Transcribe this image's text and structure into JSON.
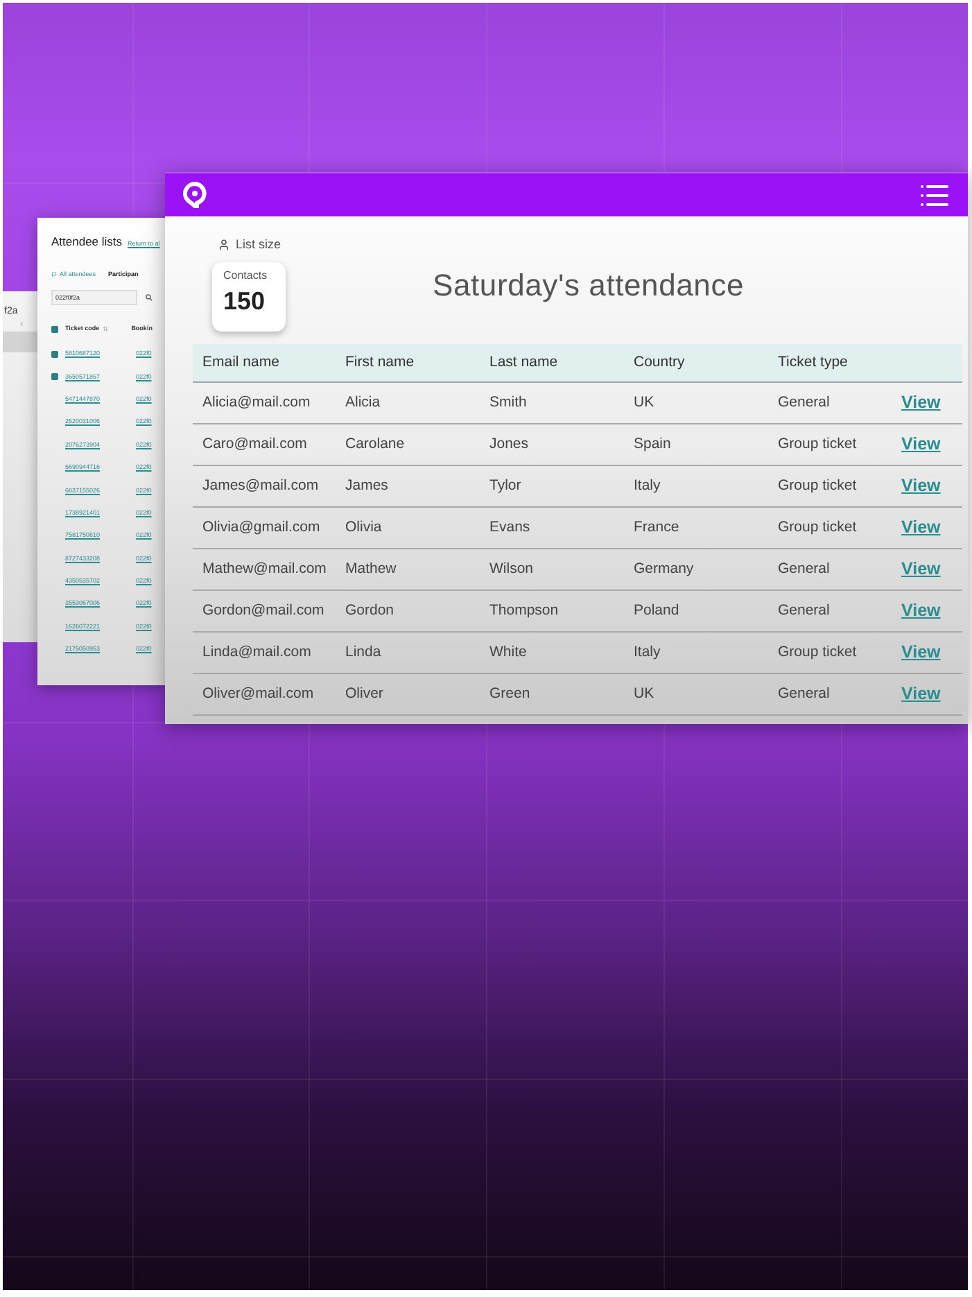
{
  "left_window": {
    "text": "f2a"
  },
  "attendee_window": {
    "title": "Attendee lists",
    "link": "Return to al",
    "tabs": [
      {
        "label": "All attendees",
        "selected": true
      },
      {
        "label": "Participan",
        "selected": false
      }
    ],
    "search": {
      "value": "022f0f2a"
    },
    "header_checked": true,
    "columns": [
      "Ticket code",
      "Bookin"
    ],
    "rows": [
      {
        "checked": true,
        "ticket_code": "5810687120",
        "booking": "022f0"
      },
      {
        "checked": true,
        "ticket_code": "3650571867",
        "booking": "022f0"
      },
      {
        "checked": false,
        "ticket_code": "5471447870",
        "booking": "022f0"
      },
      {
        "checked": false,
        "ticket_code": "2620031006",
        "booking": "022f0"
      },
      {
        "checked": false,
        "ticket_code": "2076273904",
        "booking": "022f0"
      },
      {
        "checked": false,
        "ticket_code": "6690944716",
        "booking": "022f0"
      },
      {
        "checked": false,
        "ticket_code": "6837155026",
        "booking": "022f0"
      },
      {
        "checked": false,
        "ticket_code": "1738921401",
        "booking": "022f0"
      },
      {
        "checked": false,
        "ticket_code": "7581750810",
        "booking": "022f0"
      },
      {
        "checked": false,
        "ticket_code": "8727433208",
        "booking": "022f0"
      },
      {
        "checked": false,
        "ticket_code": "4350535702",
        "booking": "022f0"
      },
      {
        "checked": false,
        "ticket_code": "3553067006",
        "booking": "022f0"
      },
      {
        "checked": false,
        "ticket_code": "1626072221",
        "booking": "022f0"
      },
      {
        "checked": false,
        "ticket_code": "2175050953",
        "booking": "022f0"
      }
    ]
  },
  "list_size": {
    "label": "List size",
    "card_label": "Contacts",
    "count": "150"
  },
  "title": "Saturday's attendance",
  "table": {
    "columns": [
      "Email name",
      "First name",
      "Last name",
      "Country",
      "Ticket type"
    ],
    "rows": [
      {
        "email": "Alicia@mail.com",
        "first_name": "Alicia",
        "last_name": "Smith",
        "country": "UK",
        "ticket_type": "General",
        "action": "View"
      },
      {
        "email": "Caro@mail.com",
        "first_name": "Carolane",
        "last_name": "Jones",
        "country": "Spain",
        "ticket_type": "Group ticket",
        "action": "View"
      },
      {
        "email": "James@mail.com",
        "first_name": "James",
        "last_name": "Tylor",
        "country": "Italy",
        "ticket_type": "Group ticket",
        "action": "View"
      },
      {
        "email": "Olivia@gmail.com",
        "first_name": "Olivia",
        "last_name": "Evans",
        "country": "France",
        "ticket_type": "Group ticket",
        "action": "View"
      },
      {
        "email": "Mathew@mail.com",
        "first_name": "Mathew",
        "last_name": "Wilson",
        "country": "Germany",
        "ticket_type": "General",
        "action": "View"
      },
      {
        "email": "Gordon@mail.com",
        "first_name": "Gordon",
        "last_name": "Thompson",
        "country": "Poland",
        "ticket_type": "General",
        "action": "View"
      },
      {
        "email": "Linda@mail.com",
        "first_name": "Linda",
        "last_name": "White",
        "country": "Italy",
        "ticket_type": "Group ticket",
        "action": "View"
      },
      {
        "email": "Oliver@mail.com",
        "first_name": "Oliver",
        "last_name": "Green",
        "country": "UK",
        "ticket_type": "General",
        "action": "View"
      }
    ]
  }
}
